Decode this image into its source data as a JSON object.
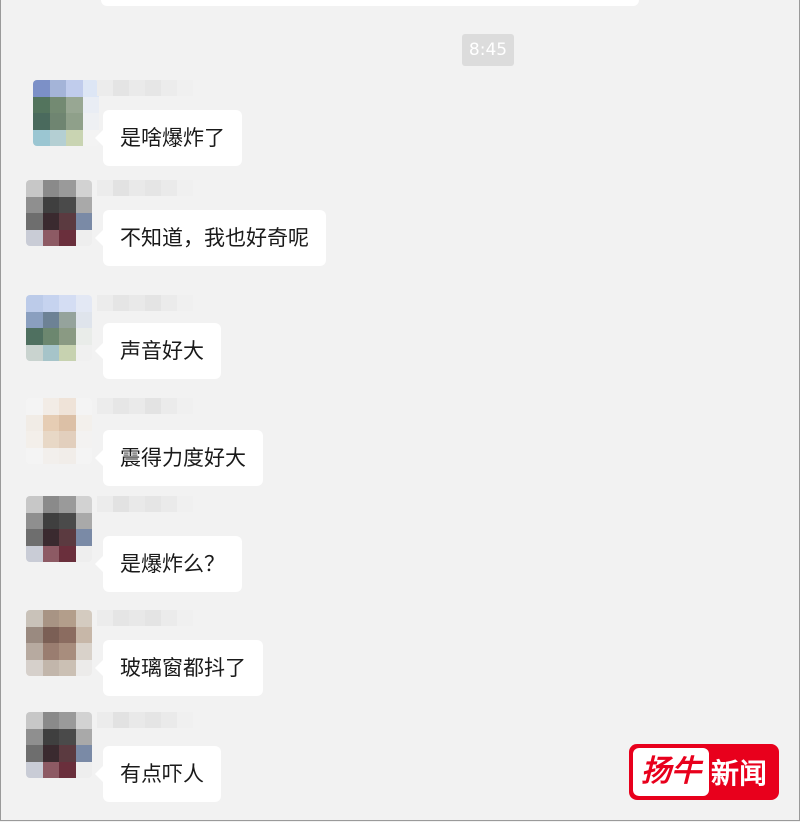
{
  "chat": {
    "timestamp": "8:45",
    "messages": [
      {
        "text": "是啥爆炸了"
      },
      {
        "text": "不知道，我也好奇呢"
      },
      {
        "text": "声音好大"
      },
      {
        "text": "震得力度好大"
      },
      {
        "text": "是爆炸么？"
      },
      {
        "text": "玻璃窗都抖了"
      },
      {
        "text": "有点吓人"
      }
    ]
  },
  "watermark": {
    "logo_text": "扬牛新闻",
    "brand_color": "#e8001c"
  }
}
